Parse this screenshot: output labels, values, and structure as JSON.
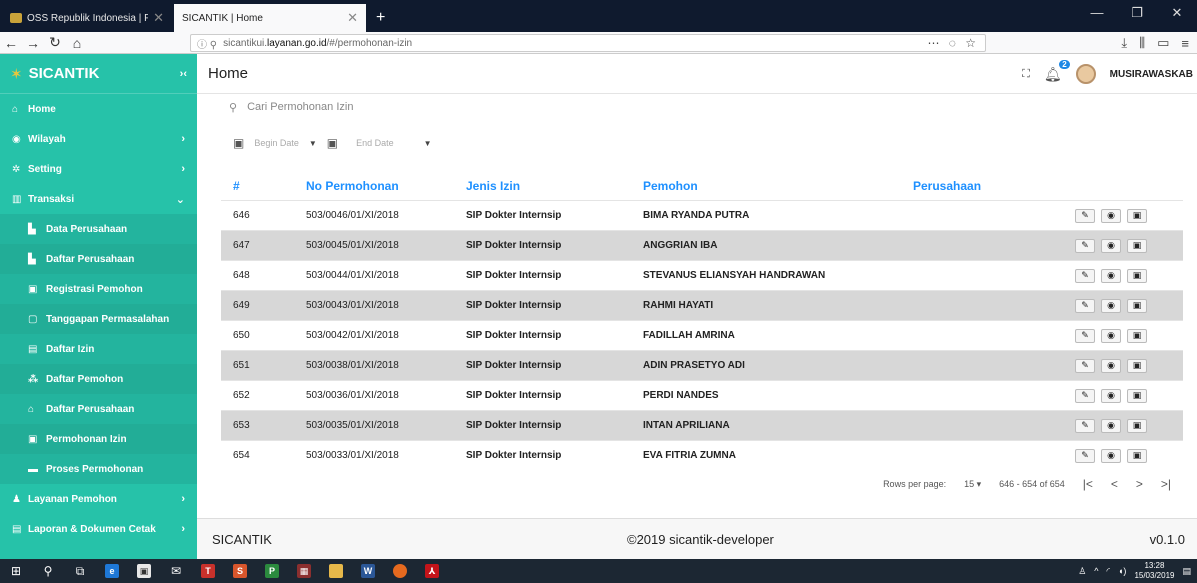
{
  "browser": {
    "tabs": [
      {
        "label": "OSS Republik Indonesia | Pelay",
        "active": false
      },
      {
        "label": "SICANTIK | Home",
        "active": true
      }
    ],
    "url_prefix": "sicantikui.",
    "url_host": "layanan.go.id",
    "url_path": "/#/permohonan-izin"
  },
  "sidebar": {
    "brand": "SICANTIK",
    "items": [
      {
        "label": "Home",
        "icon": "home-icon",
        "glyph": "⌂",
        "chevron": ""
      },
      {
        "label": "Wilayah",
        "icon": "globe-icon",
        "glyph": "◉",
        "chevron": "›"
      },
      {
        "label": "Setting",
        "icon": "gear-icon",
        "glyph": "✲",
        "chevron": "›"
      },
      {
        "label": "Transaksi",
        "icon": "table-icon",
        "glyph": "▥",
        "chevron": "⌄"
      }
    ],
    "subitems": [
      {
        "label": "Data Perusahaan",
        "icon": "chart-icon",
        "glyph": "▙"
      },
      {
        "label": "Daftar Perusahaan",
        "icon": "chart-icon",
        "glyph": "▙"
      },
      {
        "label": "Registrasi Pemohon",
        "icon": "id-card-icon",
        "glyph": "▣"
      },
      {
        "label": "Tanggapan Permasalahan",
        "icon": "square-icon",
        "glyph": "▢"
      },
      {
        "label": "Daftar Izin",
        "icon": "book-icon",
        "glyph": "▤"
      },
      {
        "label": "Daftar Pemohon",
        "icon": "users-icon",
        "glyph": "⁂"
      },
      {
        "label": "Daftar Perusahaan",
        "icon": "building-icon",
        "glyph": "⌂"
      },
      {
        "label": "Permohonan Izin",
        "icon": "id-card-icon",
        "glyph": "▣"
      },
      {
        "label": "Proses Permohonan",
        "icon": "list-icon",
        "glyph": "▬"
      }
    ],
    "bottom_items": [
      {
        "label": "Layanan Pemohon",
        "icon": "user-icon",
        "glyph": "♟",
        "chevron": "›"
      },
      {
        "label": "Laporan & Dokumen Cetak",
        "icon": "document-icon",
        "glyph": "▤",
        "chevron": "›"
      }
    ]
  },
  "header": {
    "title": "Home",
    "notification_count": "2",
    "username": "MUSIRAWASKAB"
  },
  "search": {
    "placeholder": "Cari Permohonan Izin"
  },
  "filters": {
    "begin_date": "Begin Date",
    "end_date": "End Date"
  },
  "table": {
    "columns": [
      "#",
      "No Permohonan",
      "Jenis Izin",
      "Pemohon",
      "Perusahaan"
    ],
    "rows": [
      {
        "id": "646",
        "no": "503/0046/01/XI/2018",
        "jenis": "SIP Dokter Internsip",
        "pemohon": "BIMA RYANDA PUTRA",
        "perusahaan": ""
      },
      {
        "id": "647",
        "no": "503/0045/01/XI/2018",
        "jenis": "SIP Dokter Internsip",
        "pemohon": "ANGGRIAN IBA",
        "perusahaan": ""
      },
      {
        "id": "648",
        "no": "503/0044/01/XI/2018",
        "jenis": "SIP Dokter Internsip",
        "pemohon": "STEVANUS ELIANSYAH HANDRAWAN",
        "perusahaan": ""
      },
      {
        "id": "649",
        "no": "503/0043/01/XI/2018",
        "jenis": "SIP Dokter Internsip",
        "pemohon": "RAHMI HAYATI",
        "perusahaan": ""
      },
      {
        "id": "650",
        "no": "503/0042/01/XI/2018",
        "jenis": "SIP Dokter Internsip",
        "pemohon": "FADILLAH AMRINA",
        "perusahaan": ""
      },
      {
        "id": "651",
        "no": "503/0038/01/XI/2018",
        "jenis": "SIP Dokter Internsip",
        "pemohon": "ADIN PRASETYO ADI",
        "perusahaan": ""
      },
      {
        "id": "652",
        "no": "503/0036/01/XI/2018",
        "jenis": "SIP Dokter Internsip",
        "pemohon": "PERDI NANDES",
        "perusahaan": ""
      },
      {
        "id": "653",
        "no": "503/0035/01/XI/2018",
        "jenis": "SIP Dokter Internsip",
        "pemohon": "INTAN APRILIANA",
        "perusahaan": ""
      },
      {
        "id": "654",
        "no": "503/0033/01/XI/2018",
        "jenis": "SIP Dokter Internsip",
        "pemohon": "EVA FITRIA ZUMNA",
        "perusahaan": ""
      }
    ]
  },
  "pagination": {
    "rows_per_page_label": "Rows per page:",
    "rows_per_page": "15",
    "range": "646 - 654 of 654"
  },
  "footer": {
    "left": "SICANTIK",
    "center": "©2019 sicantik-developer",
    "right": "v0.1.0"
  },
  "taskbar": {
    "time": "13:28",
    "date": "15/03/2019"
  },
  "colors": {
    "sidebar": "#26c2a9",
    "accent": "#1e90ff",
    "row_alt": "#d7d7d7"
  }
}
